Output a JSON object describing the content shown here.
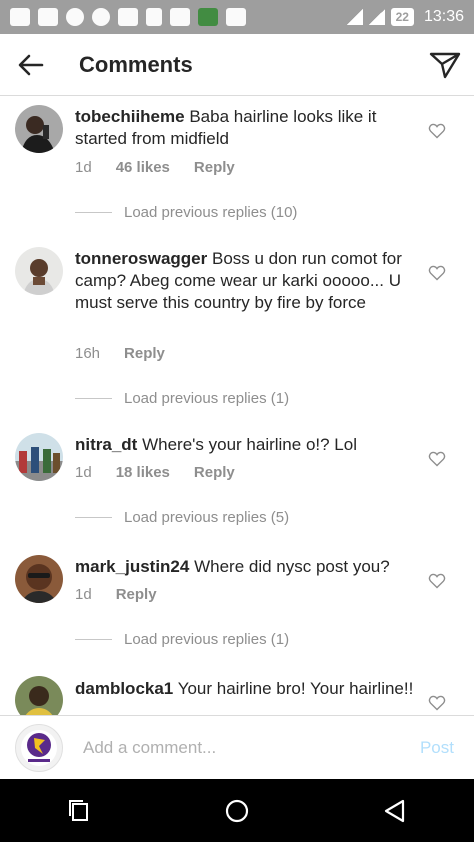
{
  "status_bar": {
    "time": "13:36",
    "battery": "22",
    "icons": [
      "message-icon",
      "screenshot-icon",
      "g-icon",
      "opera-icon",
      "facebook-icon",
      "alert-icon",
      "chat-icon",
      "app-icon",
      "mail-icon",
      "network-icon",
      "signal-icon",
      "signal-icon"
    ]
  },
  "header": {
    "title": "Comments"
  },
  "comments": [
    {
      "username": "tobechiiheme",
      "text": "Baba hairline looks like it started from midfield",
      "time": "1d",
      "likes": "46 likes",
      "reply_label": "Reply",
      "load_replies": "Load previous replies (10)"
    },
    {
      "username": "tonneroswagger",
      "text": "Boss u don run comot for camp? Abeg come wear ur karki ooooo... U must serve this country by fire by force",
      "time": "16h",
      "likes": "",
      "reply_label": "Reply",
      "load_replies": "Load previous replies (1)"
    },
    {
      "username": "nitra_dt",
      "text": "Where's your hairline o!? Lol",
      "time": "1d",
      "likes": "18 likes",
      "reply_label": "Reply",
      "load_replies": "Load previous replies (5)"
    },
    {
      "username": "mark_justin24",
      "text": "Where did nysc post you?",
      "time": "1d",
      "likes": "",
      "reply_label": "Reply",
      "load_replies": "Load previous replies (1)"
    },
    {
      "username": "damblocka1",
      "text": "Your hairline bro! Your hairline!!",
      "time": "",
      "likes": "",
      "reply_label": "",
      "load_replies": ""
    }
  ],
  "add_comment": {
    "placeholder": "Add a comment...",
    "post_label": "Post",
    "post_color": "#b2dffc"
  },
  "nav": {
    "icons": [
      "recents-icon",
      "home-icon",
      "back-icon"
    ]
  },
  "colors": {
    "status_bar": "#9e9e9e",
    "text": "#262626",
    "meta": "#8e8e8e"
  }
}
